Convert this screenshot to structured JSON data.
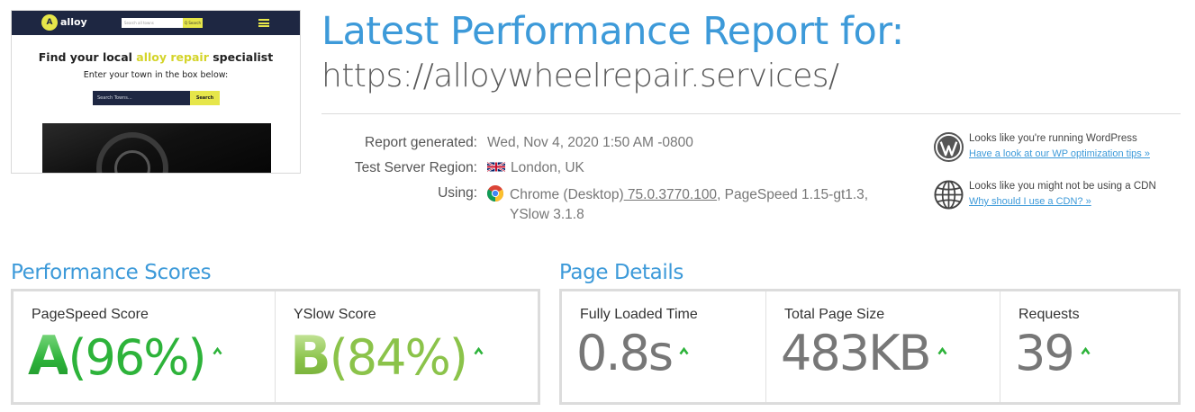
{
  "thumbnail": {
    "logo_badge": "A",
    "logo_text": "alloy",
    "nav_search_placeholder": "Search all towns",
    "nav_search_button": "Q Search",
    "headline_pre": "Find your local ",
    "headline_highlight": "alloy repair",
    "headline_post": " specialist",
    "subheading": "Enter your town in the box below:",
    "search_placeholder": "Search Towns...",
    "search_button": "Search"
  },
  "header": {
    "title": "Latest Performance Report for:",
    "url": "https://alloywheelrepair.services/"
  },
  "info": {
    "report_label": "Report generated:",
    "report_value": "Wed, Nov 4, 2020 1:50 AM -0800",
    "region_label": "Test Server Region:",
    "region_value": "London, UK",
    "using_label": "Using:",
    "using_browser": "Chrome (Desktop)",
    "using_version": " 75.0.3770.100",
    "using_rest": ", PageSpeed 1.15-gt1.3,",
    "using_line2": "YSlow 3.1.8"
  },
  "notices": {
    "wp_title": "Looks like you're running WordPress",
    "wp_link": "Have a look at our WP optimization tips »",
    "cdn_title": "Looks like you might not be using a CDN",
    "cdn_link": "Why should I use a CDN? »"
  },
  "performance": {
    "section_title": "Performance Scores",
    "pagespeed_label": "PageSpeed Score",
    "pagespeed_grade": "A",
    "pagespeed_pct": "(96%)",
    "yslow_label": "YSlow Score",
    "yslow_grade": "B",
    "yslow_pct": "(84%)"
  },
  "page_details": {
    "section_title": "Page Details",
    "load_label": "Fully Loaded Time",
    "load_value": "0.8s",
    "size_label": "Total Page Size",
    "size_value": "483KB",
    "requests_label": "Requests",
    "requests_value": "39"
  },
  "colors": {
    "brand_blue": "#3d9ad9",
    "grade_a": "#2db33a",
    "grade_b": "#8bc34a",
    "caret_green": "#2db33a"
  },
  "icons": {
    "wordpress": "wordpress-icon",
    "globe": "globe-icon",
    "chrome": "chrome-icon",
    "flag": "uk-flag-icon",
    "caret": "caret-up-icon"
  }
}
